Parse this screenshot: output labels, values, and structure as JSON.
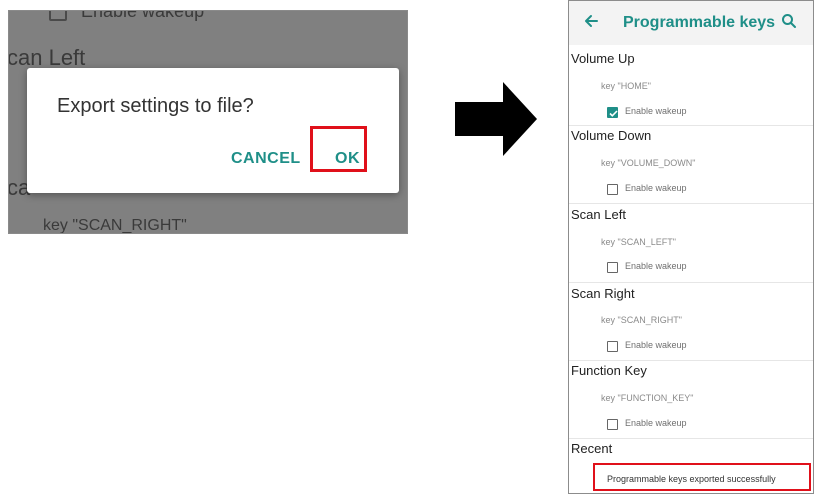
{
  "left_screenshot": {
    "background_text": {
      "enable_wakeup": "Enable wakeup",
      "scan_left": "can Left",
      "scan_right_partial": "ca",
      "key": "key \"SCAN_RIGHT\""
    },
    "dialog": {
      "title": "Export settings to file?",
      "cancel_label": "CANCEL",
      "ok_label": "OK"
    }
  },
  "right_screenshot": {
    "appbar": {
      "title": "Programmable keys"
    },
    "sections": [
      {
        "header": "Volume Up",
        "key": "key \"HOME\"",
        "wakeup_label": "Enable wakeup",
        "wakeup_checked": true
      },
      {
        "header": "Volume Down",
        "key": "key \"VOLUME_DOWN\"",
        "wakeup_label": "Enable wakeup",
        "wakeup_checked": false
      },
      {
        "header": "Scan Left",
        "key": "key \"SCAN_LEFT\"",
        "wakeup_label": "Enable wakeup",
        "wakeup_checked": false
      },
      {
        "header": "Scan Right",
        "key": "key \"SCAN_RIGHT\"",
        "wakeup_label": "Enable wakeup",
        "wakeup_checked": false
      },
      {
        "header": "Function Key",
        "key": "key \"FUNCTION_KEY\"",
        "wakeup_label": "Enable wakeup",
        "wakeup_checked": false
      },
      {
        "header": "Recent"
      }
    ],
    "toast": "Programmable keys exported successfully"
  },
  "colors": {
    "accent": "#1f8f88",
    "highlight": "#e0101a"
  }
}
